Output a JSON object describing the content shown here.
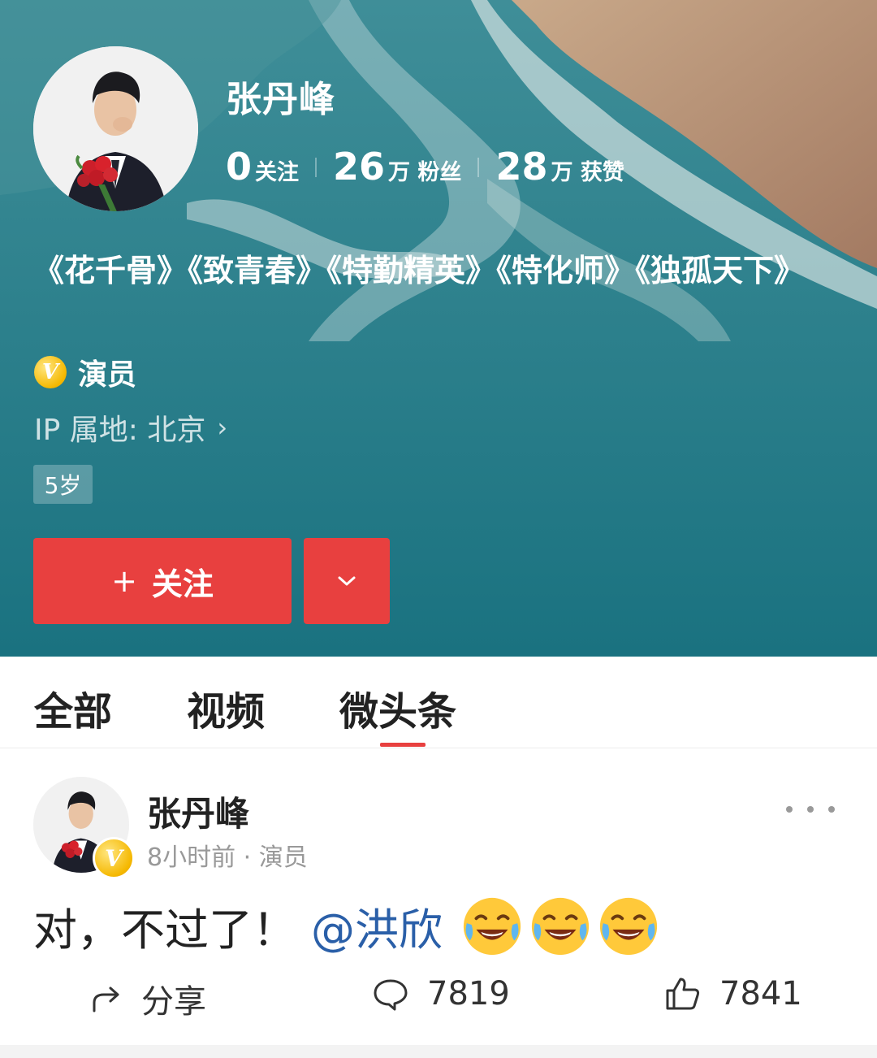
{
  "profile": {
    "name": "张丹峰",
    "stats": [
      {
        "num": "0",
        "label": "关注"
      },
      {
        "num": "26",
        "label": "万 粉丝"
      },
      {
        "num": "28",
        "label": "万 获赞"
      }
    ],
    "bio": "《花千骨》《致青春》《特勤精英》《特化师》《独孤天下》",
    "verify_mark": "V",
    "verify_label": "演员",
    "ip_location": "IP 属地: 北京",
    "ip_chevron": "›",
    "age_badge": "5岁",
    "follow_plus": "+",
    "follow_label": "关注",
    "accent_color": "#e8403f"
  },
  "tabs": [
    {
      "label": "全部"
    },
    {
      "label": "视频"
    },
    {
      "label": "微头条",
      "active": true
    }
  ],
  "post": {
    "author": "张丹峰",
    "verify_mark": "V",
    "meta": "8小时前 · 演员",
    "text": "对，不过了！",
    "mention": "@洪欣",
    "emoji": [
      "laugh-cry-emoji",
      "laugh-cry-emoji",
      "laugh-cry-emoji"
    ],
    "actions": {
      "share_label": "分享",
      "comment_count": "7819",
      "like_count": "7841"
    }
  },
  "icons": {
    "follow_more": "chevron-down-icon",
    "menu": "more-dots-icon",
    "share": "share-arrow-icon",
    "comment": "comment-bubble-icon",
    "like": "thumbs-up-icon"
  }
}
